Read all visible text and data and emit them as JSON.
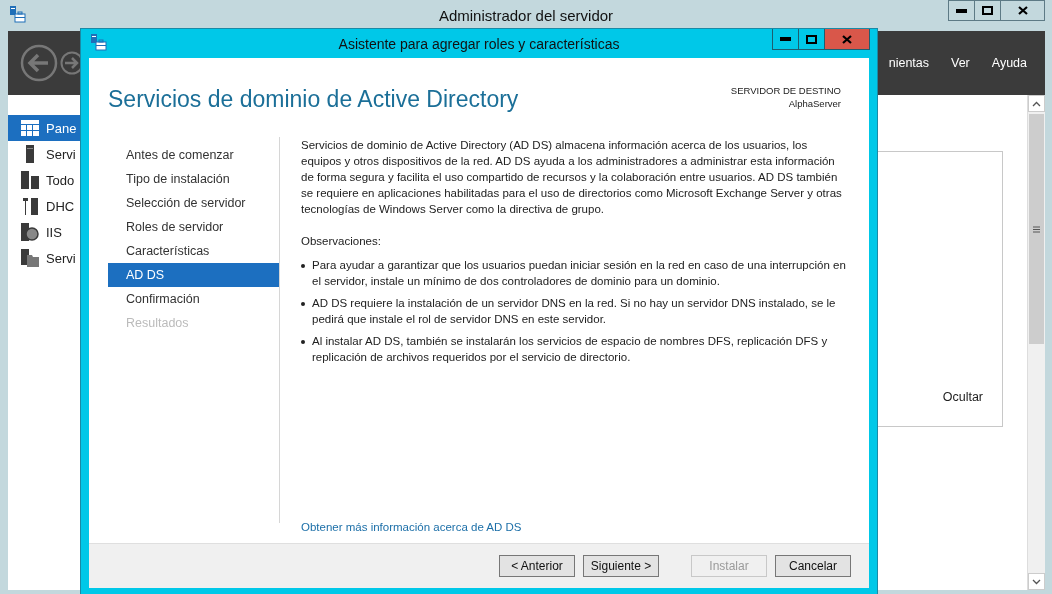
{
  "main_window": {
    "title": "Administrador del servidor",
    "menu": [
      {
        "label": "nientas"
      },
      {
        "label": "Ver"
      },
      {
        "label": "Ayuda"
      }
    ],
    "sidebar": {
      "items": [
        {
          "label": "Pane",
          "kind": "dashboard",
          "selected": true
        },
        {
          "label": "Servi",
          "kind": "server",
          "selected": false
        },
        {
          "label": "Todo",
          "kind": "servers",
          "selected": false
        },
        {
          "label": "DHC",
          "kind": "dhcp",
          "selected": false
        },
        {
          "label": "IIS",
          "kind": "iis",
          "selected": false
        },
        {
          "label": "Servi",
          "kind": "files",
          "selected": false
        }
      ]
    },
    "panel": {
      "button": "Ocultar"
    }
  },
  "wizard": {
    "title": "Asistente para agregar roles y características",
    "heading": "Servicios de dominio de Active Directory",
    "destination": {
      "label": "SERVIDOR DE DESTINO",
      "server": "AlphaServer"
    },
    "steps": [
      {
        "label": "Antes de comenzar",
        "selected": false,
        "disabled": false
      },
      {
        "label": "Tipo de instalación",
        "selected": false,
        "disabled": false
      },
      {
        "label": "Selección de servidor",
        "selected": false,
        "disabled": false
      },
      {
        "label": "Roles de servidor",
        "selected": false,
        "disabled": false
      },
      {
        "label": "Características",
        "selected": false,
        "disabled": false
      },
      {
        "label": "AD DS",
        "selected": true,
        "disabled": false
      },
      {
        "label": "Confirmación",
        "selected": false,
        "disabled": false
      },
      {
        "label": "Resultados",
        "selected": false,
        "disabled": true
      }
    ],
    "description": "Servicios de dominio de Active Directory (AD DS) almacena información acerca de los usuarios, los equipos y otros dispositivos de la red. AD DS ayuda a los administradores a administrar esta información de forma segura y facilita el uso compartido de recursos y la colaboración entre usuarios. AD DS también se requiere en aplicaciones habilitadas para el uso de directorios como Microsoft Exchange Server y otras tecnologías de Windows Server como la directiva de grupo.",
    "notes_heading": "Observaciones:",
    "notes": [
      "Para ayudar a garantizar que los usuarios puedan iniciar sesión en la red en caso de una interrupción en el servidor, instale un mínimo de dos controladores de dominio para un dominio.",
      "AD DS requiere la instalación de un servidor DNS en la red. Si no hay un servidor DNS instalado, se le pedirá que instale el rol de servidor DNS en este servidor.",
      "Al instalar AD DS, también se instalarán los servicios de espacio de nombres DFS, replicación DFS y replicación de archivos requeridos por el servicio de directorio."
    ],
    "link": "Obtener más información acerca de AD DS",
    "buttons": [
      {
        "label": "< Anterior",
        "disabled": false
      },
      {
        "label": "Siguiente >",
        "disabled": false
      },
      {
        "label": "Instalar",
        "disabled": true
      },
      {
        "label": "Cancelar",
        "disabled": false
      }
    ]
  }
}
